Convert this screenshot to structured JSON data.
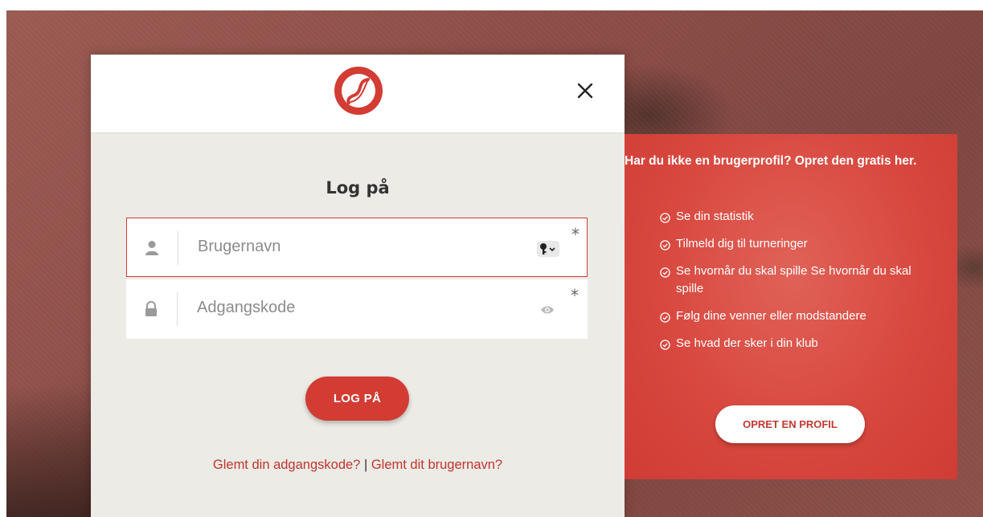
{
  "modal": {
    "title": "Log på",
    "username_placeholder": "Brugernavn",
    "password_placeholder": "Adgangskode",
    "required_mark": "*",
    "login_button": "LOG PÅ",
    "forgot_password": "Glemt din adgangskode?",
    "separator": "|",
    "forgot_username": "Glemt dit brugernavn?"
  },
  "promo": {
    "heading": "Har du ikke en brugerprofil? Opret den gratis her.",
    "benefits": [
      "Se din statistik",
      "Tilmeld dig til turneringer",
      "Se hvornår du skal spille Se hvornår du skal spille",
      "Følg dine venner eller modstandere",
      "Se hvad der sker i din klub"
    ],
    "create_button": "OPRET EN PROFIL"
  },
  "colors": {
    "brand_red": "#d23c33",
    "link_red": "#c0352e",
    "panel_bg": "#ecebe6"
  },
  "icons": {
    "logo": "dansk-tennis-forbund-logo",
    "close": "close-icon",
    "user": "user-icon",
    "lock": "lock-icon",
    "key": "key-icon",
    "eye": "eye-icon",
    "check": "check-circle-icon"
  }
}
